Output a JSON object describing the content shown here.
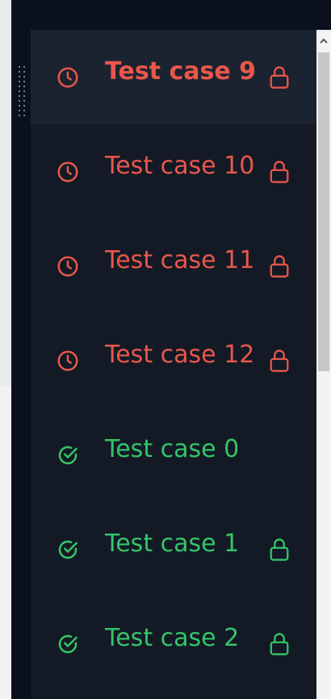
{
  "test_cases": [
    {
      "label": "Test case 9",
      "status": "pending",
      "locked": true,
      "active": true
    },
    {
      "label": "Test case 10",
      "status": "pending",
      "locked": true,
      "active": false
    },
    {
      "label": "Test case 11",
      "status": "pending",
      "locked": true,
      "active": false
    },
    {
      "label": "Test case 12",
      "status": "pending",
      "locked": true,
      "active": false
    },
    {
      "label": "Test case 0",
      "status": "passed",
      "locked": false,
      "active": false
    },
    {
      "label": "Test case 1",
      "status": "passed",
      "locked": true,
      "active": false
    },
    {
      "label": "Test case 2",
      "status": "passed",
      "locked": true,
      "active": false
    }
  ],
  "icons": {
    "pending": "clock-icon",
    "passed": "circle-check-icon",
    "lock": "lock-icon",
    "scroll_up": "chevron-up-icon"
  },
  "colors": {
    "pending": "#e9574b",
    "passed": "#35c468",
    "background": "#131a26",
    "active_row": "#1c2330"
  }
}
